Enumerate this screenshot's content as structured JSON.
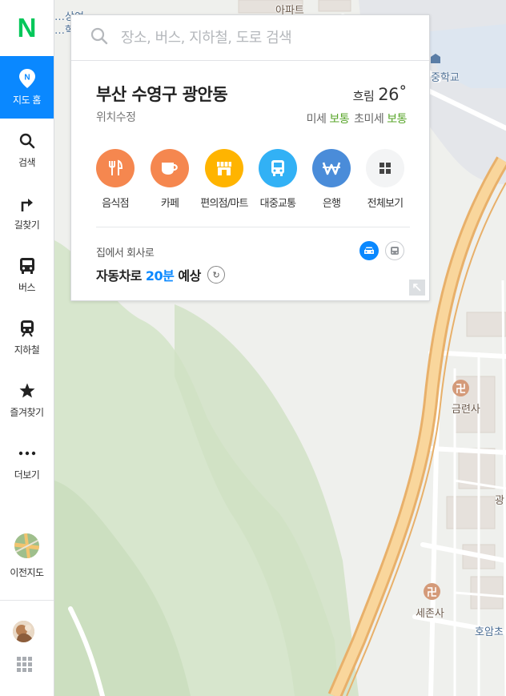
{
  "app": {
    "logo": "N"
  },
  "sidebar": {
    "items": [
      {
        "label": "지도 홈",
        "icon": "map-pin-icon",
        "active": true
      },
      {
        "label": "검색",
        "icon": "search-icon"
      },
      {
        "label": "길찾기",
        "icon": "directions-icon"
      },
      {
        "label": "버스",
        "icon": "bus-icon"
      },
      {
        "label": "지하철",
        "icon": "subway-icon"
      },
      {
        "label": "즐겨찾기",
        "icon": "star-icon"
      },
      {
        "label": "더보기",
        "icon": "more-icon"
      }
    ],
    "prev_map": {
      "label": "이전지도"
    },
    "accent_color": "#0a88ff"
  },
  "search": {
    "placeholder": "장소, 버스, 지하철, 도로 검색"
  },
  "location": {
    "title": "부산 수영구 광안동",
    "edit_label": "위치수정",
    "weather": {
      "condition": "흐림",
      "temperature": "26˚"
    },
    "dust": {
      "fine_label": "미세",
      "fine_value": "보통",
      "ultrafine_label": "초미세",
      "ultrafine_value": "보통"
    }
  },
  "categories": [
    {
      "label": "음식점",
      "icon": "restaurant-icon",
      "color": "#f5874f"
    },
    {
      "label": "카페",
      "icon": "cafe-icon",
      "color": "#f5874f"
    },
    {
      "label": "편의점/마트",
      "icon": "store-icon",
      "color": "#ffb400"
    },
    {
      "label": "대중교통",
      "icon": "bus-icon",
      "color": "#32b1f5"
    },
    {
      "label": "은행",
      "icon": "bank-icon",
      "color": "#4a8cd9"
    },
    {
      "label": "전체보기",
      "icon": "grid-icon",
      "color": "#f3f4f5"
    }
  ],
  "commute": {
    "label": "집에서 회사로",
    "mode_prefix": "자동차로",
    "duration": "20분",
    "suffix": "예상"
  },
  "map_labels": {
    "apartment": "아파트",
    "top_left": "…상여",
    "top_left2": "…학교",
    "middle_school": "중학교",
    "temple1": "금련사",
    "temple2": "세존사",
    "right_edge": "광",
    "bottom_right": "호암초"
  }
}
